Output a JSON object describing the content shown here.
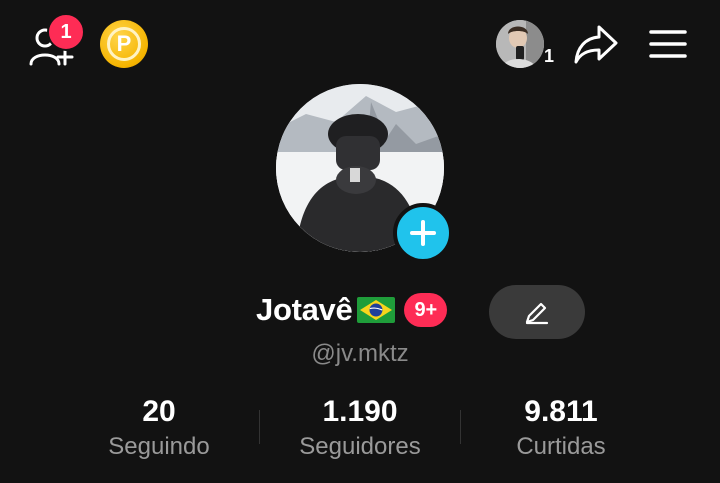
{
  "header": {
    "friends_badge": "1",
    "coin_letter": "P",
    "mini_avatar_count": "1"
  },
  "profile": {
    "display_name": "Jotavê",
    "flag_icon": "brazil-flag-icon",
    "notification_pill": "9+",
    "username": "@jv.mktz"
  },
  "stats": [
    {
      "value": "20",
      "label": "Seguindo"
    },
    {
      "value": "1.190",
      "label": "Seguidores"
    },
    {
      "value": "9.811",
      "label": "Curtidas"
    }
  ],
  "colors": {
    "background": "#121212",
    "accent_red": "#fe2c55",
    "accent_blue": "#20c3ec",
    "coin_gold": "#f5b400",
    "edit_button": "#3a3a3a",
    "secondary_text": "#8a8a8a"
  }
}
